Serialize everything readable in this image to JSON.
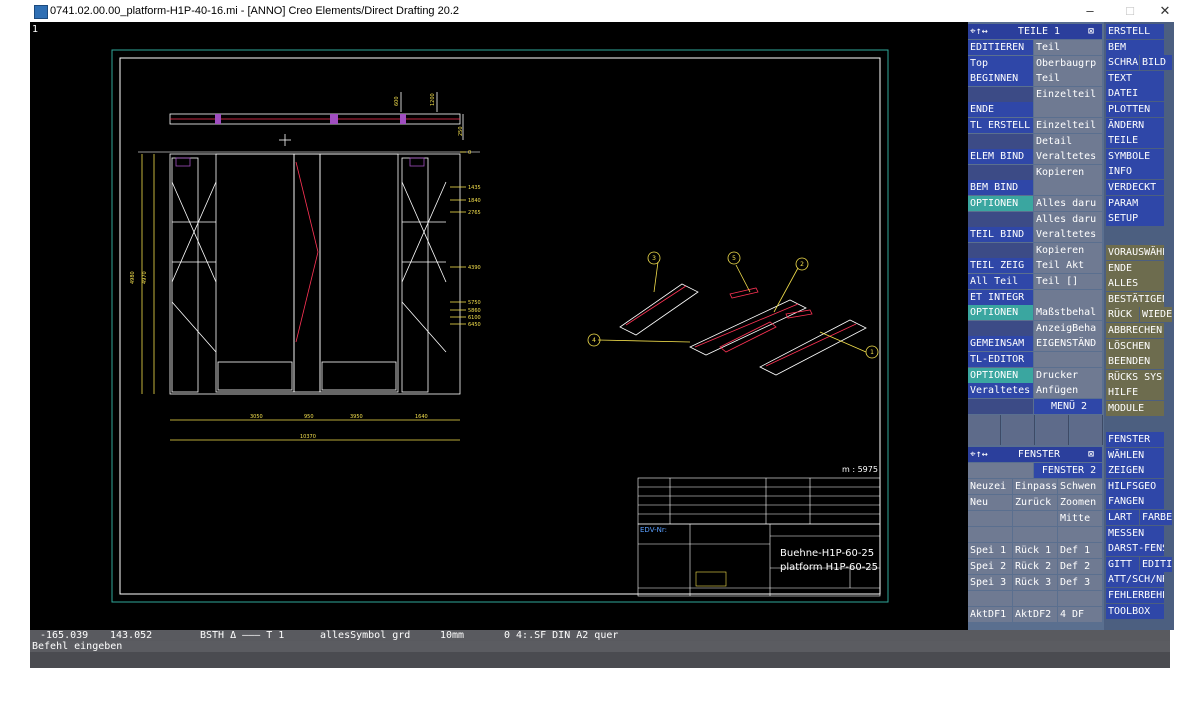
{
  "window": {
    "title": "0741.02.00.00_platform-H1P-40-16.mi - [ANNO]  Creo Elements/Direct Drafting 20.2",
    "minimize": "–",
    "maximize": "□",
    "close": "✕"
  },
  "viewport": {
    "label": "1"
  },
  "drawing": {
    "scale_label": "m : 5975",
    "title_line1": "Buehne-H1P-60-25",
    "title_line2": "platform H1P-60-25",
    "edv_label": "EDV-Nr:",
    "dims": [
      "3050",
      "950",
      "3950",
      "1640",
      "10370",
      "4980",
      "4970",
      "1435",
      "1840",
      "2765",
      "4390",
      "5750",
      "5860",
      "6100",
      "6450",
      "600",
      "1200",
      "250",
      "0"
    ],
    "balloons": [
      "3",
      "5",
      "2",
      "4",
      "1"
    ]
  },
  "status": {
    "coords_x": "-165.039",
    "coords_y": "143.052",
    "bsth": "BSTH Δ ——— T 1",
    "symbol": "allesSymbol grd",
    "grid": "10mm",
    "sheet": "0 4:.SF DIN A2 quer",
    "prompt": "Befehl eingeben"
  },
  "teile_menu": {
    "header": "TEILE 1",
    "header_icon": "⌖↑↔",
    "pin": "⊠",
    "left": [
      "EDITIEREN",
      "Top",
      "BEGINNEN",
      "",
      "ENDE",
      "TL ERSTELL",
      "",
      "ELEM BIND",
      "",
      "BEM BIND",
      "OPTIONEN",
      "",
      "TEIL BIND",
      "",
      "TEIL ZEIG",
      "All Teil",
      "ET INTEGR",
      "OPTIONEN",
      "",
      "GEMEINSAM",
      "TL-EDITOR",
      "OPTIONEN",
      "Veraltetes",
      ""
    ],
    "right": [
      "Teil",
      "Oberbaugrp",
      "Teil",
      "Einzelteil",
      "",
      "Einzelteil",
      "Detail",
      "Veraltetes",
      "Kopieren",
      "",
      "Alles daru",
      "Alles daru",
      "Veraltetes",
      "Kopieren",
      "Teil Akt",
      "Teil []",
      "",
      "Maßstbehal",
      "AnzeigBeha",
      "EIGENSTÄND",
      "",
      "Drucker",
      "Anfügen",
      "MENÜ 2"
    ]
  },
  "fenster_menu": {
    "header": "FENSTER",
    "header_icon": "⌖↑↔",
    "pin": "⊠",
    "row0": [
      "",
      "FENSTER 2"
    ],
    "rows": [
      [
        "Neuzei",
        "Einpass",
        "Schwen"
      ],
      [
        "Neu",
        "Zurück",
        "Zoomen"
      ],
      [
        "",
        "",
        "Mitte"
      ],
      [
        "",
        "",
        ""
      ],
      [
        "Spei 1",
        "Rück 1",
        "Def 1"
      ],
      [
        "Spei 2",
        "Rück 2",
        "Def 2"
      ],
      [
        "Spei 3",
        "Rück 3",
        "Def 3"
      ],
      [
        "",
        "",
        ""
      ],
      [
        "AktDF1",
        "AktDF2",
        "4 DF"
      ]
    ]
  },
  "main_menu": {
    "items_top": [
      "ERSTELL",
      "BEM",
      "SCHRA|BILD",
      "TEXT",
      "DATEI",
      "PLOTTEN",
      "ÄNDERN",
      "TEILE",
      "SYMBOLE",
      "INFO",
      "VERDECKT",
      "PARAM",
      "SETUP"
    ],
    "items_mid": [
      "VORAUSWÄHL",
      "ENDE",
      "ALLES",
      "BESTÄTIGEN",
      "RÜCK|WIEDE",
      "ABBRECHEN",
      "LÖSCHEN",
      "BEENDEN",
      "RÜCKS SYS",
      "HILFE",
      "MODULE"
    ],
    "items_bot": [
      "FENSTER",
      "WÄHLEN",
      "ZEIGEN",
      "HILFSGEO",
      "FANGEN",
      "LART|FARBE",
      "MESSEN",
      "DARST-FENS",
      "GITT|EDITI",
      "ATT/SCH/NR",
      "FEHLERBEHE",
      "TOOLBOX"
    ]
  }
}
